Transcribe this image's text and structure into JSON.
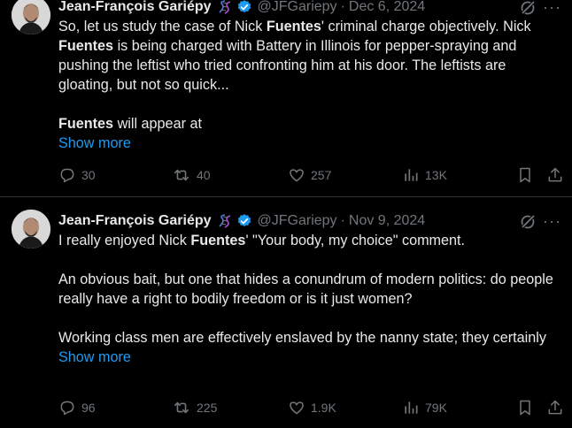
{
  "posts": [
    {
      "author_name": "Jean-François Gariépy",
      "handle": "@JFGariepy",
      "separator": "·",
      "date": "Dec 6, 2024",
      "more_label": "···",
      "paragraphs": [
        [
          {
            "t": "So, let us study the case of Nick ",
            "b": false
          },
          {
            "t": "Fuentes",
            "b": true
          },
          {
            "t": "' criminal charge objectively. Nick ",
            "b": false
          },
          {
            "t": "Fuentes",
            "b": true
          },
          {
            "t": " is being charged with Battery in Illinois for pepper-spraying and pushing the leftist who tried confronting him at his door. The leftists are gloating, but not so quick...",
            "b": false
          }
        ],
        [
          {
            "t": "Fuentes",
            "b": true
          },
          {
            "t": " will appear at",
            "b": false
          }
        ]
      ],
      "show_more": "Show more",
      "stats": {
        "replies": "30",
        "reposts": "40",
        "likes": "257",
        "views": "13K"
      }
    },
    {
      "author_name": "Jean-François Gariépy",
      "handle": "@JFGariepy",
      "separator": "·",
      "date": "Nov 9, 2024",
      "more_label": "···",
      "paragraphs": [
        [
          {
            "t": "I really enjoyed Nick ",
            "b": false
          },
          {
            "t": "Fuentes",
            "b": true
          },
          {
            "t": "' \"Your body, my choice\" comment.",
            "b": false
          }
        ],
        [
          {
            "t": "An obvious bait, but one that hides a conundrum of modern politics: do people really have a right to bodily freedom or is it just women?",
            "b": false
          }
        ],
        [
          {
            "t": "Working class men are effectively enslaved by the nanny state; they certainly",
            "b": false
          }
        ]
      ],
      "show_more": "Show more",
      "stats": {
        "replies": "96",
        "reposts": "225",
        "likes": "1.9K",
        "views": "79K"
      }
    }
  ],
  "colors": {
    "background": "#000000",
    "text": "#e7e9ea",
    "muted": "#71767b",
    "link": "#1d9bf0",
    "verified": "#1d9bf0",
    "divider": "#2f3336"
  },
  "icons": [
    "dna-icon",
    "verified-badge-icon",
    "grok-icon",
    "more-icon",
    "reply-icon",
    "repost-icon",
    "like-icon",
    "views-icon",
    "bookmark-icon",
    "share-icon"
  ]
}
